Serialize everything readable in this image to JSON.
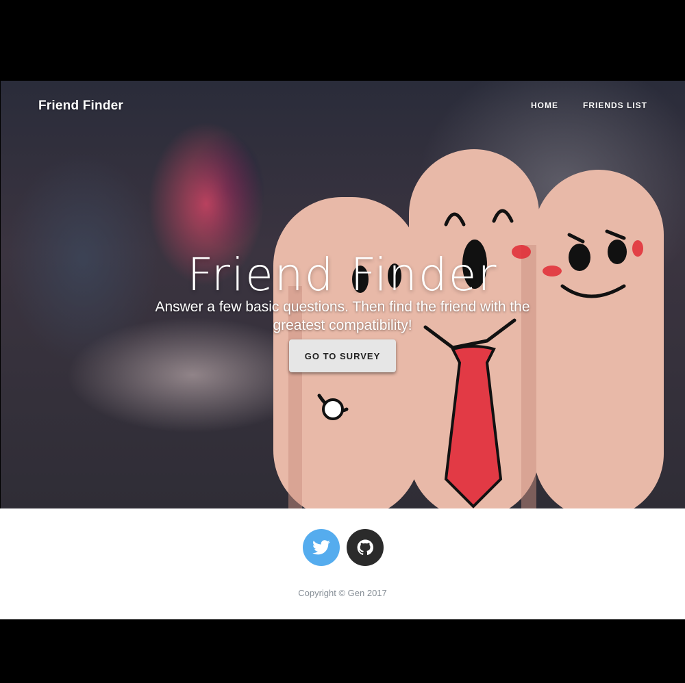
{
  "header": {
    "brand": "Friend Finder",
    "nav": [
      {
        "label": "HOME"
      },
      {
        "label": "FRIENDS LIST"
      }
    ]
  },
  "hero": {
    "title": "Friend Finder",
    "subtitle": "Answer a few basic questions. Then find the friend with the greatest compatibility!",
    "cta_label": "GO TO SURVEY"
  },
  "footer": {
    "social": [
      {
        "icon": "twitter-icon",
        "color": "#55acee"
      },
      {
        "icon": "github-icon",
        "color": "#2b2b2b"
      }
    ],
    "copyright": "Copyright © Gen 2017"
  }
}
